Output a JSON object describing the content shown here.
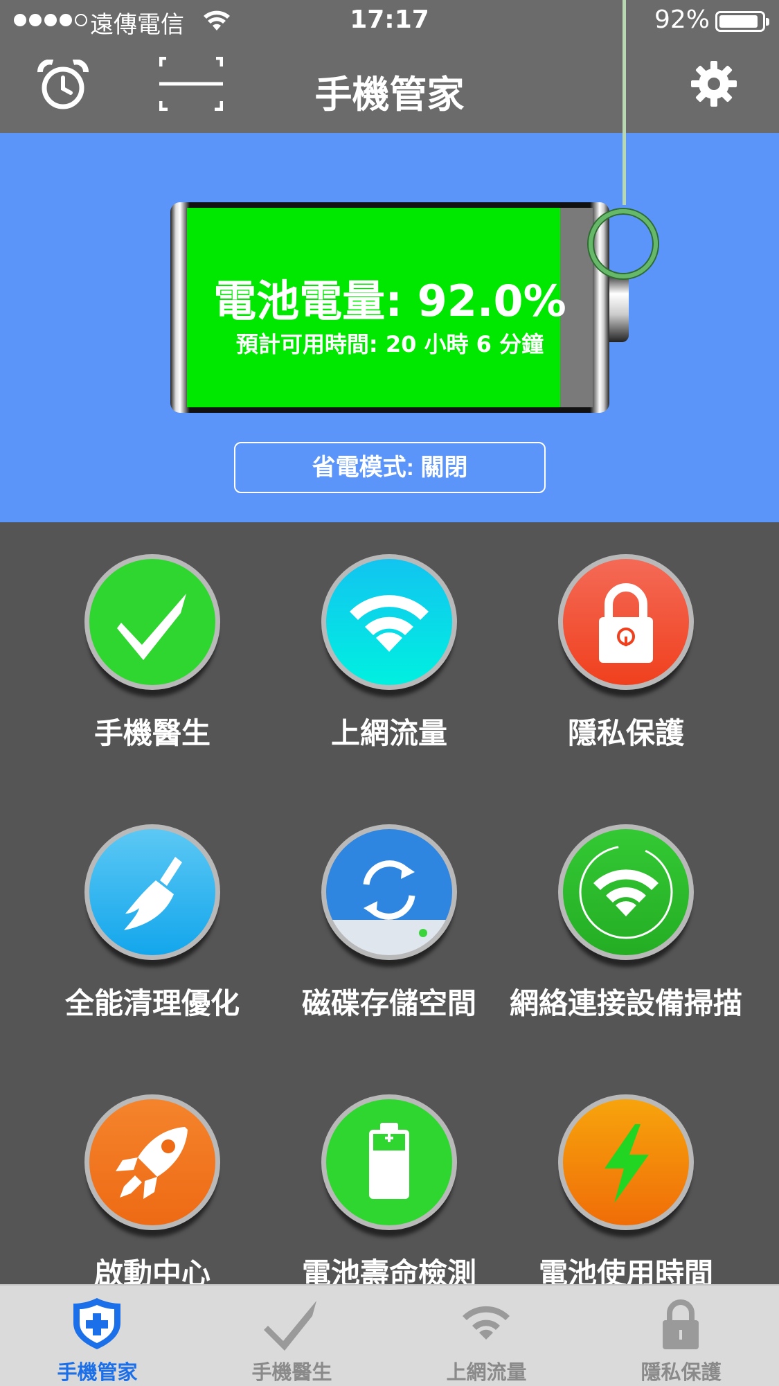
{
  "status_bar": {
    "carrier": "遠傳電信",
    "time": "17:17",
    "battery_percent": "92%",
    "battery_level": 0.92
  },
  "nav": {
    "title": "手機管家",
    "icons": [
      "alarm-clock-icon",
      "scan-icon",
      "gear-icon"
    ]
  },
  "battery": {
    "charge_text": "電池電量: 92.0%",
    "charge_level": 0.92,
    "remaining_text": "預計可用時間: 20 小時 6 分鐘",
    "fill_color": "#00e800",
    "power_saving_label": "省電模式: 關閉"
  },
  "colors": {
    "header": "#6b6b6b",
    "hero": "#5c95fa",
    "grid_bg": "#555555",
    "tab_active": "#1b6fe8",
    "tab_inactive": "#8a8a8a"
  },
  "features": [
    {
      "label": "手機醫生",
      "icon": "checkmark-icon",
      "color": "#2fd62f"
    },
    {
      "label": "上網流量",
      "icon": "wifi-icon",
      "color": "#12d6e8"
    },
    {
      "label": "隱私保護",
      "icon": "lock-icon",
      "color": "#f25a3a"
    },
    {
      "label": "全能清理優化",
      "icon": "broom-icon",
      "color": "#2ab0f0"
    },
    {
      "label": "磁碟存儲空間",
      "icon": "disk-sync-icon",
      "color": "#2f86e0"
    },
    {
      "label": "網絡連接設備掃描",
      "icon": "wifi-scan-icon",
      "color": "#2cbd2c"
    },
    {
      "label": "啟動中心",
      "icon": "rocket-icon",
      "color": "#f27a22"
    },
    {
      "label": "電池壽命檢測",
      "icon": "battery-icon",
      "color": "#2fd62f"
    },
    {
      "label": "電池使用時間",
      "icon": "lightning-icon",
      "color": "#f58a0a"
    }
  ],
  "tabs": [
    {
      "label": "手機管家",
      "icon": "shield-plus-icon",
      "active": true
    },
    {
      "label": "手機醫生",
      "icon": "checkmark-icon",
      "active": false
    },
    {
      "label": "上網流量",
      "icon": "wifi-icon",
      "active": false
    },
    {
      "label": "隱私保護",
      "icon": "lock-icon",
      "active": false
    }
  ]
}
